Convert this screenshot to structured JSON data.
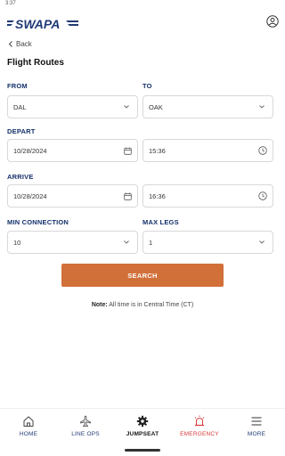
{
  "status_bar": {
    "time": "3:37"
  },
  "header": {
    "logo_text": "SWAPA",
    "profile_icon": "person-circle-icon"
  },
  "back": {
    "label": "Back"
  },
  "page_title": "Flight Routes",
  "form": {
    "from": {
      "label": "FROM",
      "value": "DAL"
    },
    "to": {
      "label": "TO",
      "value": "OAK"
    },
    "depart": {
      "label": "DEPART",
      "date": "10/28/2024",
      "time": "15:36"
    },
    "arrive": {
      "label": "ARRIVE",
      "date": "10/28/2024",
      "time": "16:36"
    },
    "min_connection": {
      "label": "MIN CONNECTION",
      "value": "10"
    },
    "max_legs": {
      "label": "MAX LEGS",
      "value": "1"
    }
  },
  "search_button": "SEARCH",
  "note": {
    "prefix": "Note:",
    "text": " All time is in Central Time (CT)"
  },
  "nav": {
    "items": [
      {
        "label": "HOME",
        "icon": "home-icon"
      },
      {
        "label": "LINE OPS",
        "icon": "airplane-icon"
      },
      {
        "label": "JUMPSEAT",
        "icon": "gear-icon"
      },
      {
        "label": "EMERGENCY",
        "icon": "alarm-light-icon"
      },
      {
        "label": "MORE",
        "icon": "menu-icon"
      }
    ],
    "active_index": 2
  },
  "colors": {
    "primary": "#14306b",
    "accent": "#d2703a",
    "emergency": "#d83a3a"
  }
}
